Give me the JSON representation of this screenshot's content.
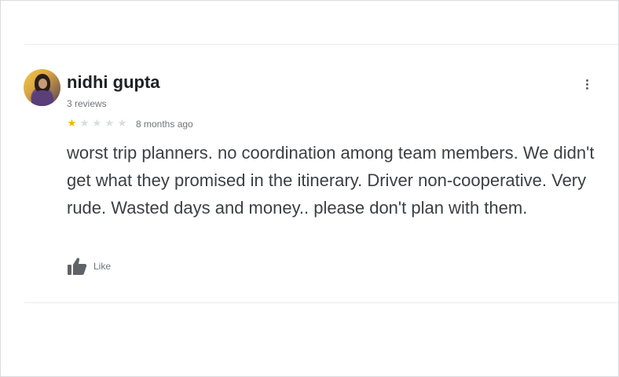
{
  "review": {
    "author": "nidhi gupta",
    "review_count": "3 reviews",
    "rating": 1,
    "max_rating": 5,
    "stars": [
      "★",
      "★",
      "★",
      "★",
      "★"
    ],
    "time_ago": "8 months ago",
    "text": "worst trip planners. no coordination among team members. We didn't get what they promised in the itinerary. Driver non-cooperative. Very rude. Wasted days and money.. please don't plan with them.",
    "like_label": "Like",
    "like_icon": "thumbs-up-icon",
    "more_icon": "more-vert-icon"
  },
  "colors": {
    "star_filled": "#f4b400",
    "star_empty": "#dadce0",
    "text": "#3c4043",
    "secondary": "#70757a"
  }
}
